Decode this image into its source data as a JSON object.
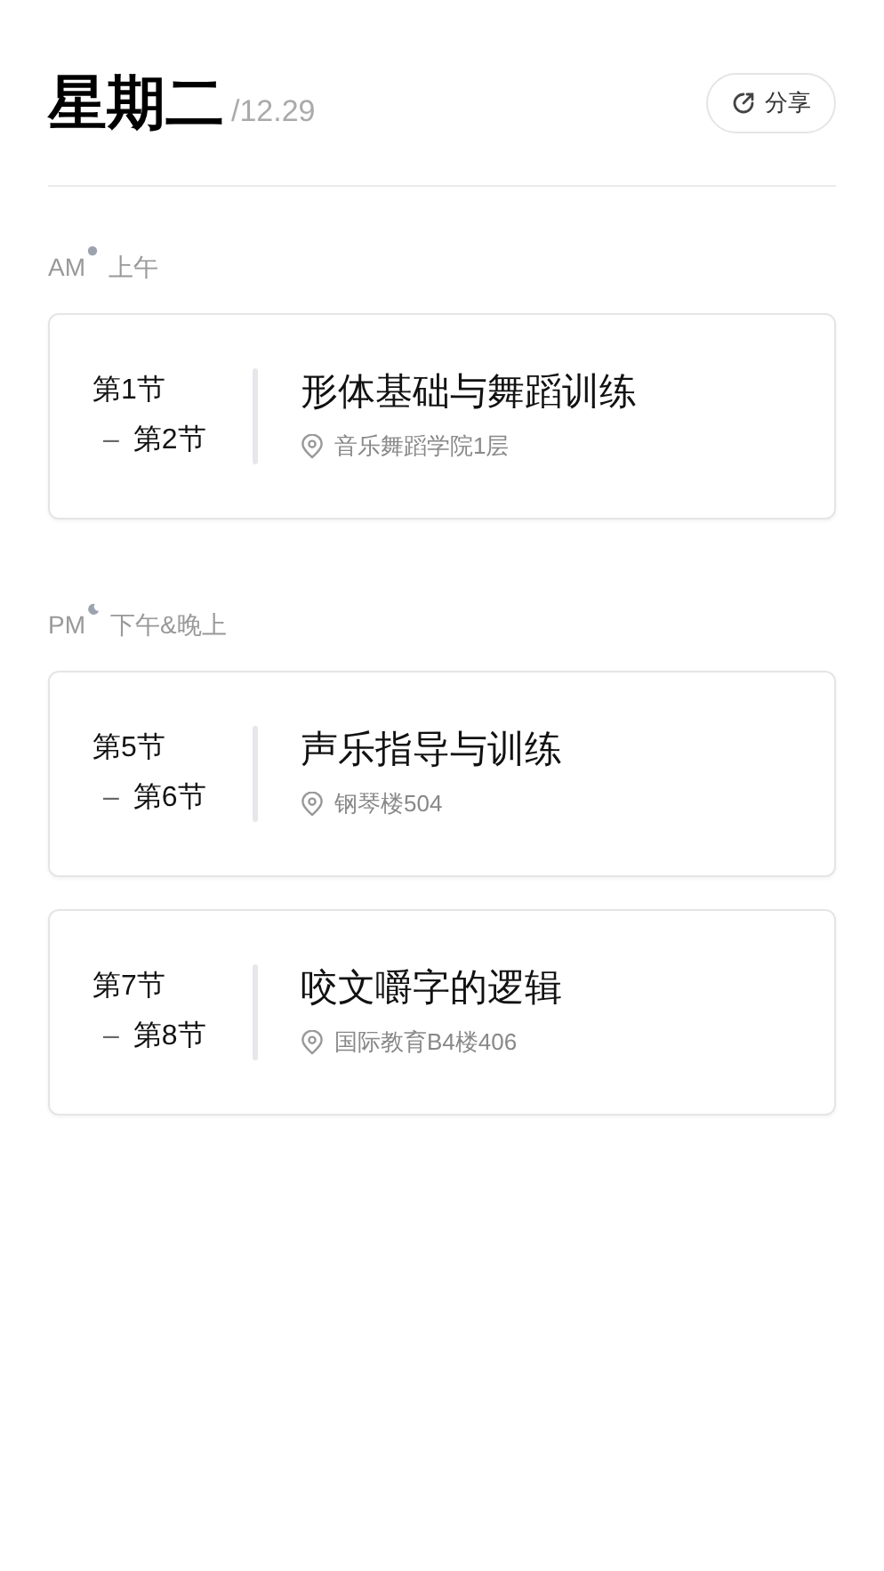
{
  "header": {
    "weekday": "星期二",
    "date": "/12.29",
    "share_button": "分享"
  },
  "sections": [
    {
      "kind": "am",
      "abbr": "AM",
      "label": "上午",
      "courses": [
        {
          "start": "第1节",
          "dash": "–",
          "end": "第2节",
          "name": "形体基础与舞蹈训练",
          "location": "音乐舞蹈学院1层"
        }
      ]
    },
    {
      "kind": "pm",
      "abbr": "PM",
      "label": "下午&晚上",
      "courses": [
        {
          "start": "第5节",
          "dash": "–",
          "end": "第6节",
          "name": "声乐指导与训练",
          "location": "钢琴楼504"
        },
        {
          "start": "第7节",
          "dash": "–",
          "end": "第8节",
          "name": "咬文嚼字的逻辑",
          "location": "国际教育B4楼406"
        }
      ]
    }
  ]
}
